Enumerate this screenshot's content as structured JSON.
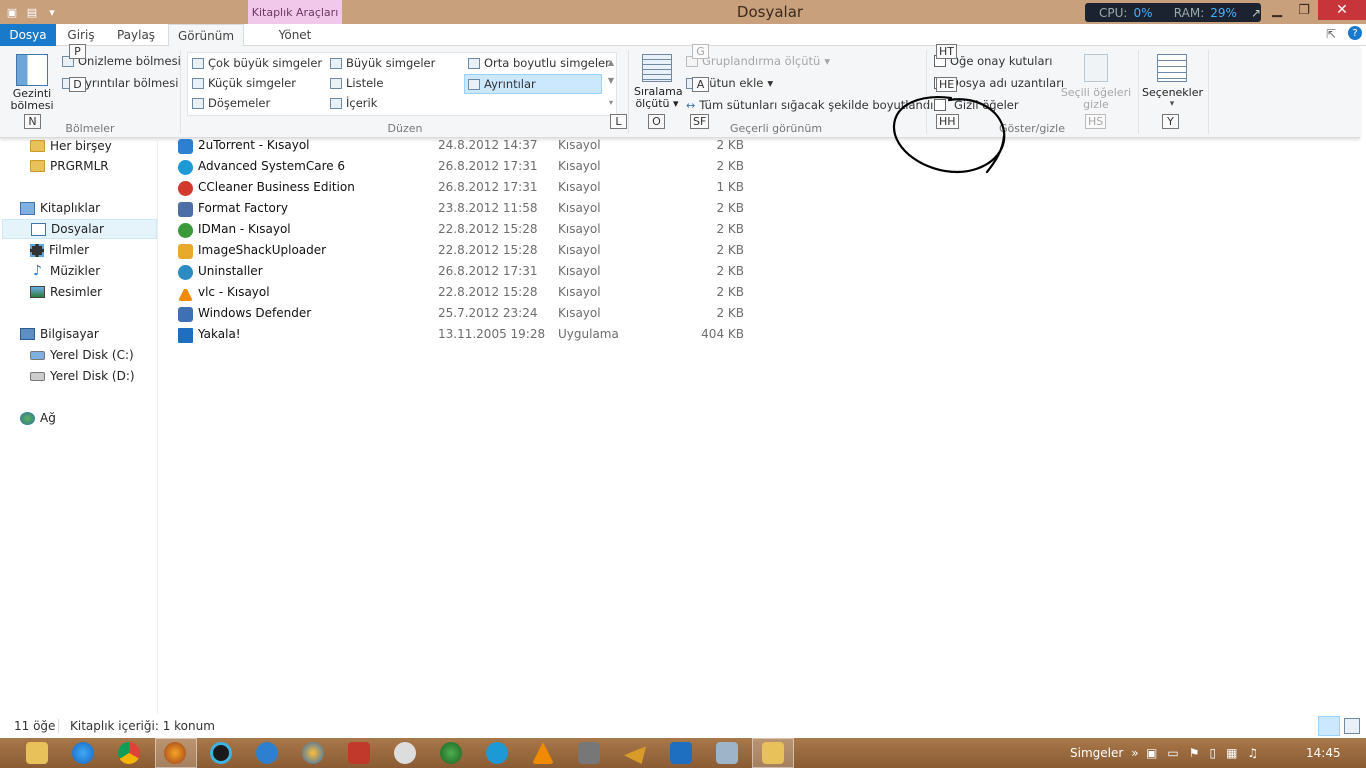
{
  "window": {
    "title": "Dosyalar",
    "context_tab": "Kitaplık Araçları",
    "perf": {
      "cpu_label": "CPU:",
      "cpu_value": "0%",
      "ram_label": "RAM:",
      "ram_value": "29%"
    }
  },
  "tabs": {
    "file": "Dosya",
    "home": "Giriş",
    "share": "Paylaş",
    "view": "Görünüm",
    "manage": "Yönet"
  },
  "ribbon": {
    "panes": {
      "nav_pane_line1": "Gezinti",
      "nav_pane_line2": "bölmesi",
      "preview_pane": "Önizleme bölmesi",
      "details_pane": "Ayrıntılar bölmesi",
      "group_label": "Bölmeler"
    },
    "layout": {
      "extra_large": "Çok büyük simgeler",
      "large": "Büyük simgeler",
      "medium": "Orta boyutlu simgeler",
      "small": "Küçük simgeler",
      "list": "Listele",
      "details": "Ayrıntılar",
      "tiles": "Döşemeler",
      "content": "İçerik",
      "group_label": "Düzen"
    },
    "current_view": {
      "sort_line1": "Sıralama",
      "sort_line2": "ölçütü",
      "group_by": "Gruplandırma ölçütü",
      "add_columns": "Sütun ekle",
      "size_all": "Tüm sütunları sığacak şekilde boyutlandır",
      "group_label": "Geçerli görünüm"
    },
    "show_hide": {
      "item_checkboxes": "Öğe onay kutuları",
      "file_extensions": "Dosya adı uzantıları",
      "hidden_items": "Gizli öğeler",
      "hide_selected_line1": "Seçili öğeleri",
      "hide_selected_line2": "gizle",
      "group_label": "Göster/gizle"
    },
    "options": "Seçenekler"
  },
  "keytips": {
    "p": "P",
    "d": "D",
    "n": "N",
    "l": "L",
    "g": "G",
    "a": "A",
    "o": "O",
    "sf": "SF",
    "ht": "HT",
    "he": "HE",
    "hh": "HH",
    "hs": "HS",
    "y": "Y"
  },
  "sidebar": {
    "everything": "Her birşey",
    "prgrmlr": "PRGRMLR",
    "libraries": "Kitaplıklar",
    "documents": "Dosyalar",
    "videos": "Filmler",
    "music": "Müzikler",
    "pictures": "Resimler",
    "computer": "Bilgisayar",
    "disk_c": "Yerel Disk (C:)",
    "disk_d": "Yerel Disk (D:)",
    "network": "Ağ"
  },
  "files": [
    {
      "name": "2uTorrent - Kısayol",
      "date": "24.8.2012 14:37",
      "type": "Kısayol",
      "size": "2 KB"
    },
    {
      "name": "Advanced SystemCare 6",
      "date": "26.8.2012 17:31",
      "type": "Kısayol",
      "size": "2 KB"
    },
    {
      "name": "CCleaner Business Edition",
      "date": "26.8.2012 17:31",
      "type": "Kısayol",
      "size": "1 KB"
    },
    {
      "name": "Format Factory",
      "date": "23.8.2012 11:58",
      "type": "Kısayol",
      "size": "2 KB"
    },
    {
      "name": "IDMan - Kısayol",
      "date": "22.8.2012 15:28",
      "type": "Kısayol",
      "size": "2 KB"
    },
    {
      "name": "ImageShackUploader",
      "date": "22.8.2012 15:28",
      "type": "Kısayol",
      "size": "2 KB"
    },
    {
      "name": "Uninstaller",
      "date": "26.8.2012 17:31",
      "type": "Kısayol",
      "size": "2 KB"
    },
    {
      "name": "vlc - Kısayol",
      "date": "22.8.2012 15:28",
      "type": "Kısayol",
      "size": "2 KB"
    },
    {
      "name": "Windows Defender",
      "date": "25.7.2012 23:24",
      "type": "Kısayol",
      "size": "2 KB"
    },
    {
      "name": "Yakala!",
      "date": "13.11.2005 19:28",
      "type": "Uygulama",
      "size": "404 KB"
    }
  ],
  "status": {
    "count": "11 öğe",
    "library_info": "Kitaplık içeriği: 1 konum"
  },
  "taskbar": {
    "toolbar_label": "Simgeler",
    "clock": "14:45"
  },
  "colors": {
    "titlebar": "#c8a07c",
    "file_tab": "#1979ca",
    "context_tab": "#f1c8e9",
    "close": "#c7353a",
    "taskbar": "#9a6a3e",
    "selection": "#cce8ff"
  }
}
